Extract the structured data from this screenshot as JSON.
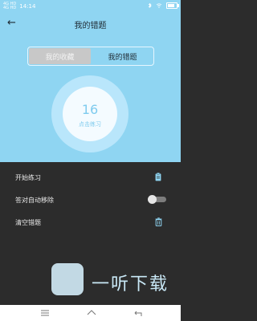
{
  "status_bar": {
    "signal_text": "4G HD\n4G HD",
    "time": "14:14",
    "battery_level_fraction": 0.8,
    "icons": [
      "bluetooth-icon",
      "wifi-icon",
      "battery-icon"
    ]
  },
  "header": {
    "back_icon": "arrow-left-icon",
    "title": "我的错题"
  },
  "tabs": [
    {
      "label": "我的收藏",
      "active": true
    },
    {
      "label": "我的错题",
      "active": false
    }
  ],
  "stats": {
    "count": "16",
    "label": "点击练习"
  },
  "menu": {
    "items": [
      {
        "label": "开始练习",
        "icon": "clipboard-icon"
      },
      {
        "label": "答对自动移除",
        "icon": "toggle-switch",
        "toggle_on": false
      },
      {
        "label": "清空错题",
        "icon": "trash-icon"
      }
    ]
  },
  "system_nav": {
    "icons": [
      "menu-lines-icon",
      "home-icon",
      "back-icon"
    ]
  },
  "watermark": {
    "text": "一听下载"
  },
  "colors": {
    "top_bg": "#8fd5f2",
    "bottom_bg": "#2c2c2c",
    "accent": "#7ecbee"
  }
}
